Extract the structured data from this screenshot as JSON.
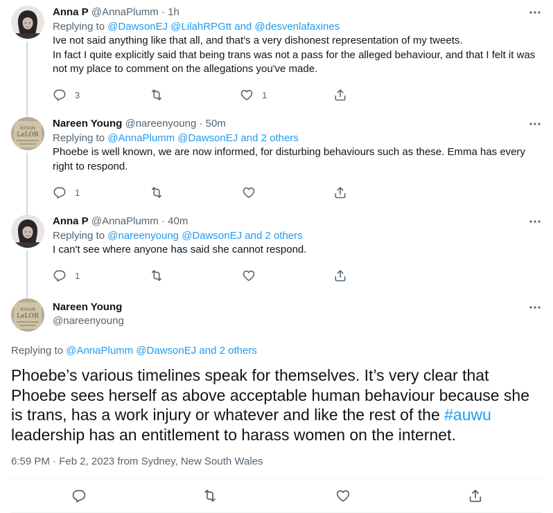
{
  "tweets": [
    {
      "name": "Anna P",
      "handle": "@AnnaPlumm",
      "time": "1h",
      "replying_prefix": "Replying to",
      "replying_to": "@DawsonEJ @LilahRPGtt and @desvenlafaxines",
      "lines": [
        "Ive not said anything like that all, and that's a very dishonest representation of my tweets.",
        "In fact I quite explicitly said that being trans was not a pass for the alleged behaviour, and that I felt it was not my place to comment on the allegations you've made."
      ],
      "replies": "3",
      "retweets": "",
      "likes": "1"
    },
    {
      "name": "Nareen Young",
      "handle": "@nareenyoung",
      "time": "50m",
      "replying_prefix": "Replying to",
      "replying_to": "@AnnaPlumm @DawsonEJ and 2 others",
      "lines": [
        "Phoebe is well known, we are now informed, for disturbing behaviours such as these. Emma has every right to respond."
      ],
      "replies": "1",
      "retweets": "",
      "likes": ""
    },
    {
      "name": "Anna P",
      "handle": "@AnnaPlumm",
      "time": "40m",
      "replying_prefix": "Replying to",
      "replying_to": "@nareenyoung @DawsonEJ and 2 others",
      "lines": [
        "I can't see where anyone has said she cannot respond."
      ],
      "replies": "1",
      "retweets": "",
      "likes": ""
    }
  ],
  "main": {
    "name": "Nareen Young",
    "handle": "@nareenyoung",
    "replying_prefix": "Replying to",
    "replying_to": "@AnnaPlumm @DawsonEJ and 2 others",
    "text_before": "Phoebe’s various timelines speak for themselves. It’s very clear that Phoebe sees herself as above acceptable human behaviour because she is trans, has a work injury or whatever and like the rest of the ",
    "hashtag": "#auwu",
    "text_after": " leadership has an entitlement to harass women on the internet.",
    "timestamp": "6:59 PM · Feb 2, 2023 from Sydney, New South Wales"
  },
  "separator": " · ",
  "icons": {
    "more": "more-icon",
    "reply": "reply-icon",
    "retweet": "retweet-icon",
    "like": "like-icon",
    "share": "share-icon"
  },
  "colors": {
    "accent": "#1d9bf0",
    "muted": "#536471",
    "text": "#0f1419",
    "thread_line": "#cfd9de",
    "divider": "#eff3f4"
  }
}
